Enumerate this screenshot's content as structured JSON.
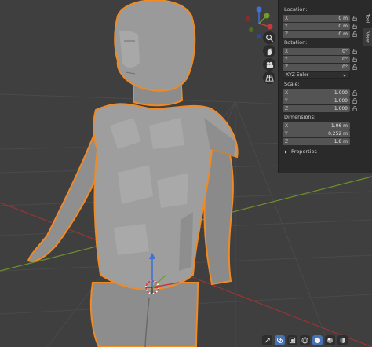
{
  "panel": {
    "location": {
      "label": "Location:",
      "x": {
        "axis": "X",
        "value": "0 m"
      },
      "y": {
        "axis": "Y",
        "value": "0 m"
      },
      "z": {
        "axis": "Z",
        "value": "0 m"
      }
    },
    "rotation": {
      "label": "Rotation:",
      "x": {
        "axis": "X",
        "value": "0°"
      },
      "y": {
        "axis": "Y",
        "value": "0°"
      },
      "z": {
        "axis": "Z",
        "value": "0°"
      },
      "mode": "XYZ Euler"
    },
    "scale": {
      "label": "Scale:",
      "x": {
        "axis": "X",
        "value": "1.000"
      },
      "y": {
        "axis": "Y",
        "value": "1.000"
      },
      "z": {
        "axis": "Z",
        "value": "1.000"
      }
    },
    "dimensions": {
      "label": "Dimensions:",
      "x": {
        "axis": "X",
        "value": "1.06 m"
      },
      "y": {
        "axis": "Y",
        "value": "0.252 m"
      },
      "z": {
        "axis": "Z",
        "value": "1.8 m"
      }
    },
    "properties_label": "Properties"
  },
  "tabs": [
    "Tool",
    "View"
  ],
  "colors": {
    "viewport_bg": "#3f3f3f",
    "selection_outline": "#f08a24",
    "axis_x": "#c23a3a",
    "axis_y": "#7aa62a",
    "accent": "#4772b3"
  },
  "icons": [
    "zoom-icon",
    "hand-pan-icon",
    "camera-icon",
    "grid-perspective-icon",
    "lock-icon",
    "chevron-down-icon",
    "disclosure-triangle-icon"
  ]
}
